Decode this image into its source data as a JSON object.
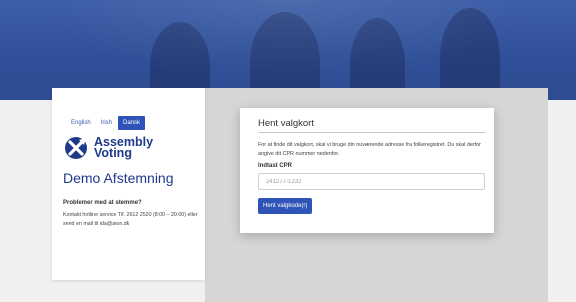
{
  "languages": {
    "english": "English",
    "irish": "Irish",
    "danish": "Dansk",
    "active": "Dansk"
  },
  "brand": {
    "line1": "Assembly",
    "line2": "Voting",
    "logo_icon": "assembly-voting-x-logo",
    "color": "#1f3a8a"
  },
  "app_title": "Demo Afstemning",
  "help": {
    "heading": "Problemer med at stemme?",
    "text": "Kontakt hotline service Tlf. 2612 2520 (8:00 – 20:00) eller send en mail til ida@aion.dk"
  },
  "form": {
    "title": "Hent valgkort",
    "description": "For at finde dit valgkort, skal vi bruge din nuværende adresse fra folkeregistret. Du skal derfor angive dit CPR nummer nedenfor.",
    "field_label": "Indtast CPR",
    "placeholder": "241277-1232",
    "value": "",
    "submit_label": "Hent valgkode(r)"
  },
  "colors": {
    "accent": "#2f54b8",
    "hero": "#2f4f98",
    "page_bg": "#f0f0f0",
    "panel_bg": "#d6d6d6"
  }
}
